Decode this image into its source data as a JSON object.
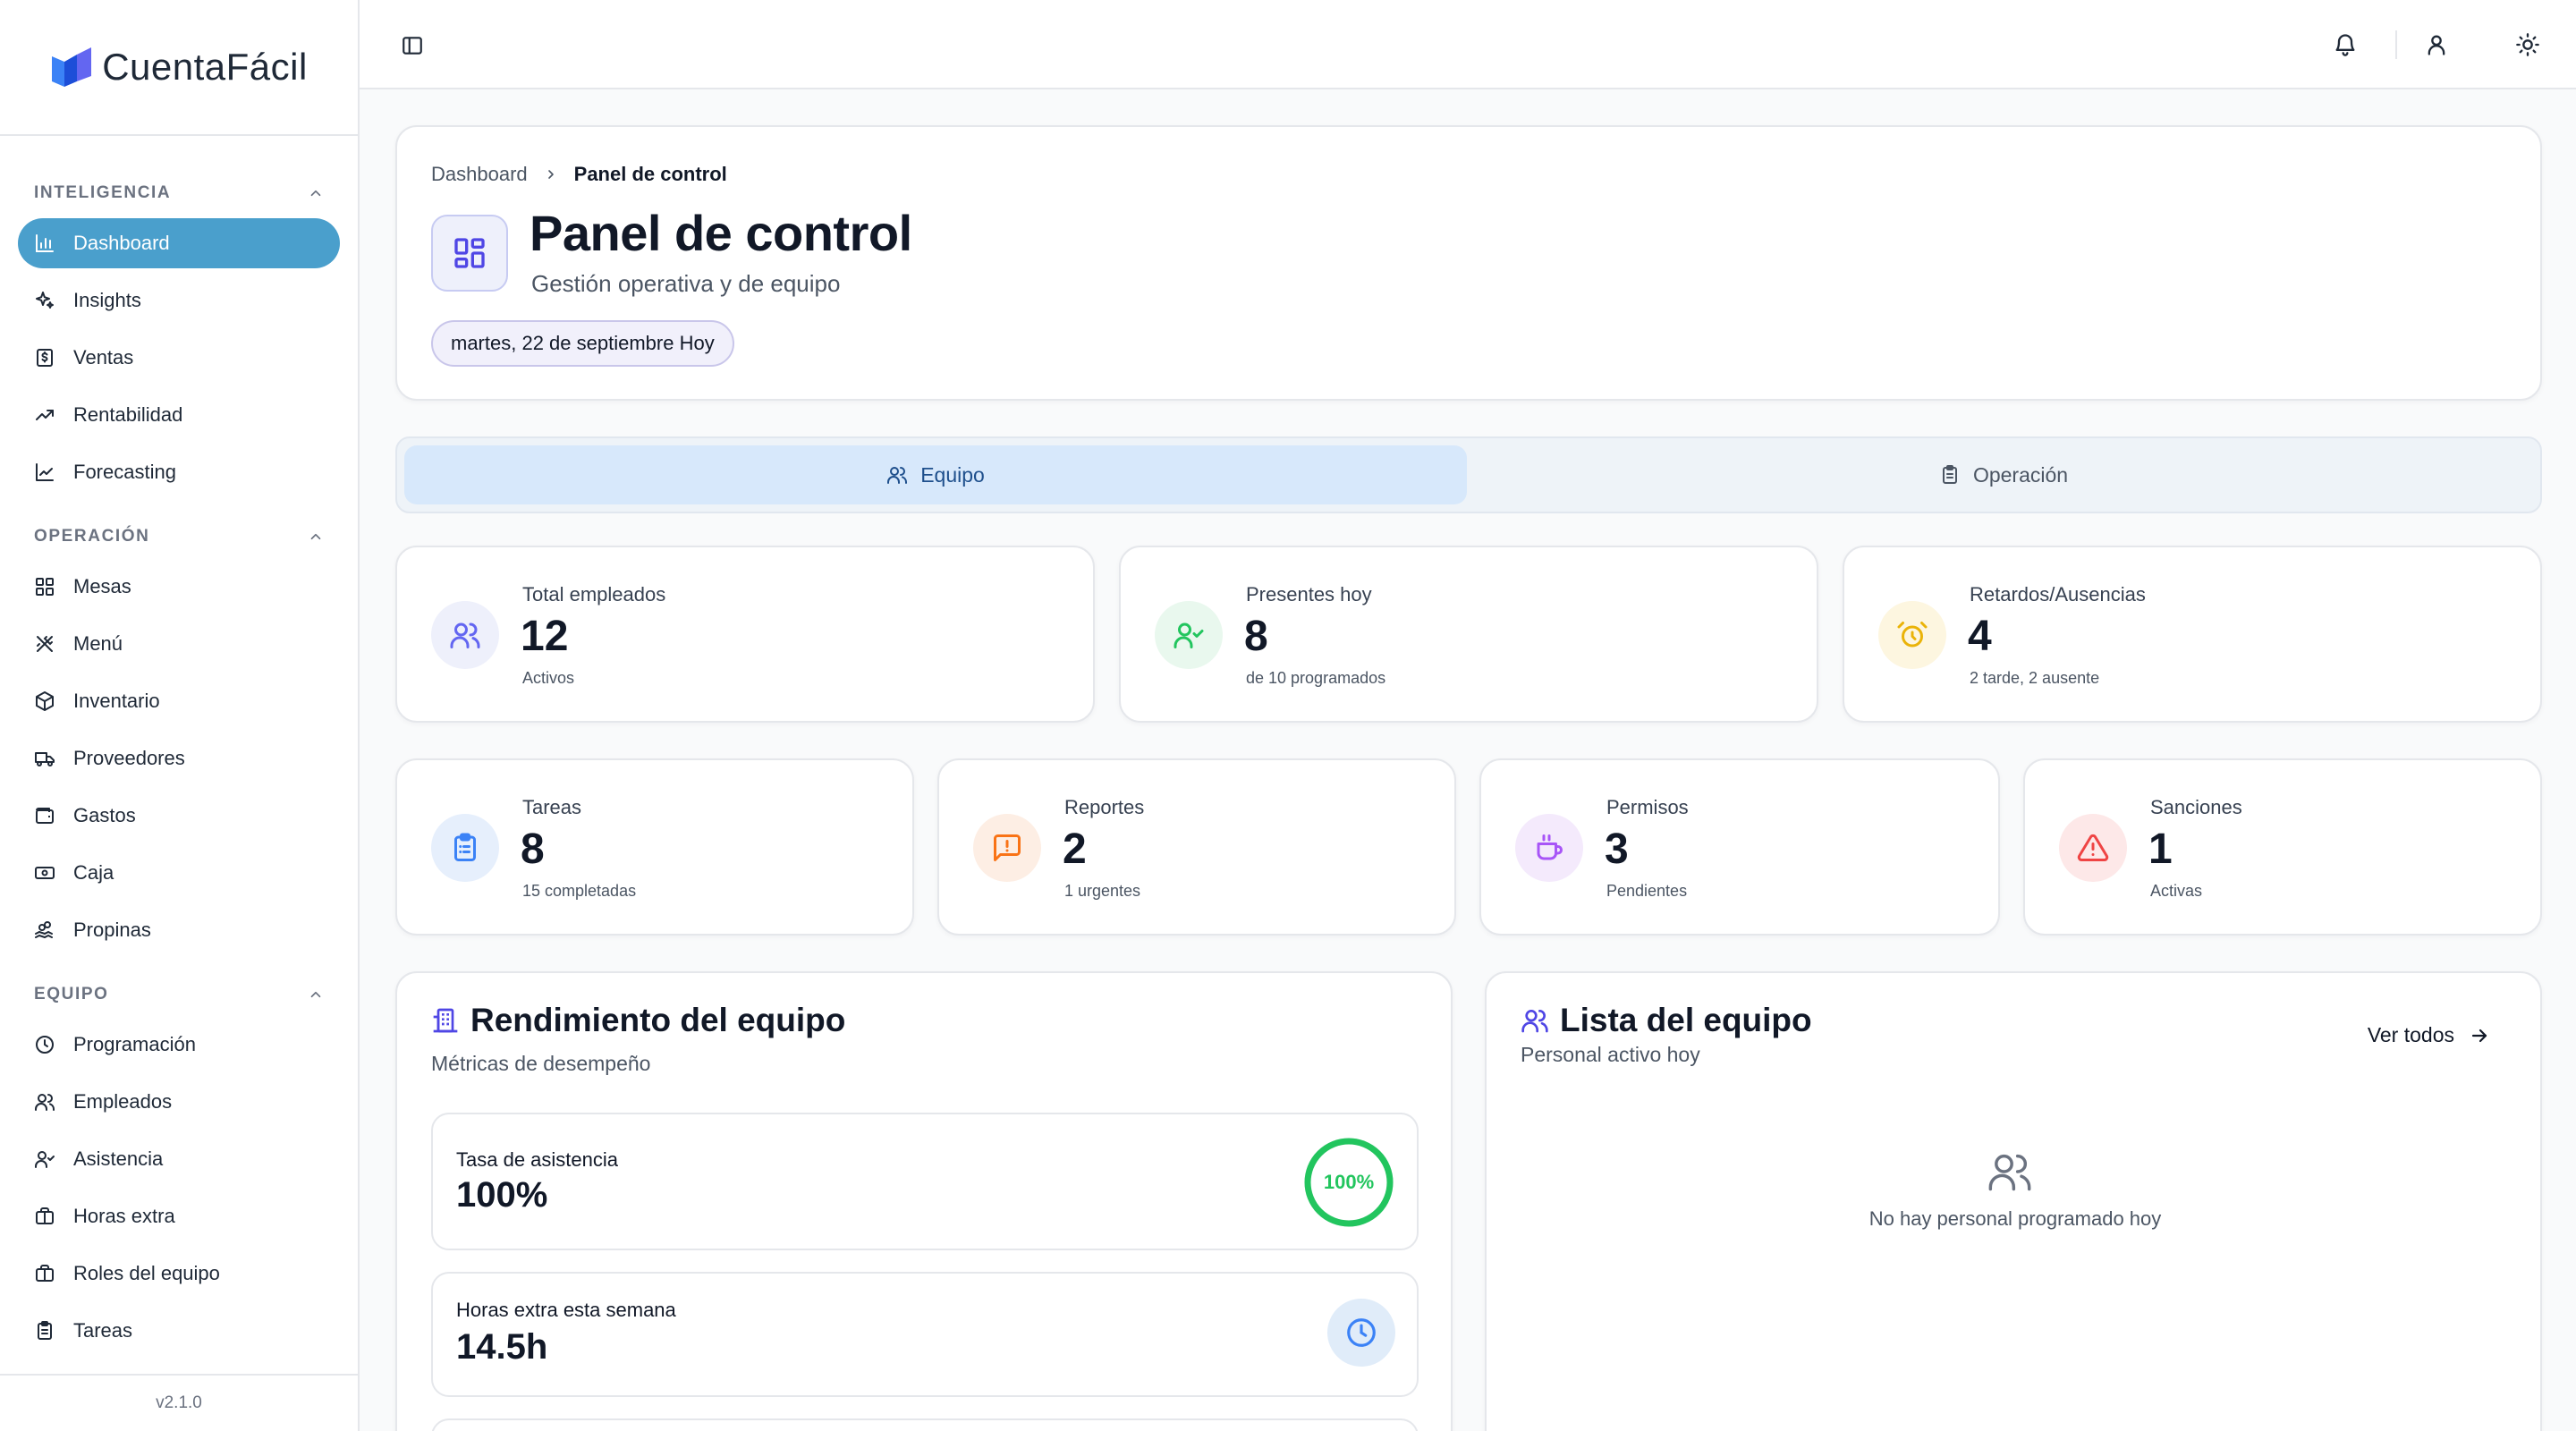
{
  "brand": {
    "name": "CuentaFácil"
  },
  "sidebar": {
    "sections": [
      {
        "title": "INTELIGENCIA",
        "items": [
          {
            "label": "Dashboard",
            "icon": "bar-chart-icon",
            "active": true
          },
          {
            "label": "Insights",
            "icon": "sparkles-icon"
          },
          {
            "label": "Ventas",
            "icon": "receipt-dollar-icon"
          },
          {
            "label": "Rentabilidad",
            "icon": "trending-up-icon"
          },
          {
            "label": "Forecasting",
            "icon": "line-chart-icon"
          }
        ]
      },
      {
        "title": "OPERACIÓN",
        "items": [
          {
            "label": "Mesas",
            "icon": "grid-icon"
          },
          {
            "label": "Menú",
            "icon": "utensils-icon"
          },
          {
            "label": "Inventario",
            "icon": "package-icon"
          },
          {
            "label": "Proveedores",
            "icon": "truck-icon"
          },
          {
            "label": "Gastos",
            "icon": "wallet-icon"
          },
          {
            "label": "Caja",
            "icon": "banknote-icon"
          },
          {
            "label": "Propinas",
            "icon": "hand-coins-icon"
          }
        ]
      },
      {
        "title": "EQUIPO",
        "items": [
          {
            "label": "Programación",
            "icon": "clock-icon"
          },
          {
            "label": "Empleados",
            "icon": "users-icon"
          },
          {
            "label": "Asistencia",
            "icon": "user-check-icon"
          },
          {
            "label": "Horas extra",
            "icon": "briefcase-icon"
          },
          {
            "label": "Roles del equipo",
            "icon": "briefcase-icon"
          },
          {
            "label": "Tareas",
            "icon": "clipboard-icon"
          }
        ]
      }
    ],
    "version": "v2.1.0"
  },
  "header": {
    "breadcrumb": [
      "Dashboard",
      "Panel de control"
    ],
    "title": "Panel de control",
    "subtitle": "Gestión operativa y de equipo",
    "date": "martes, 22 de septiembre Hoy"
  },
  "tabs": [
    {
      "label": "Equipo",
      "icon": "users-icon",
      "active": true
    },
    {
      "label": "Operación",
      "icon": "clipboard-icon",
      "active": false
    }
  ],
  "stats_row1": [
    {
      "label": "Total empleados",
      "value": "12",
      "sub": "Activos",
      "icon": "users-icon",
      "color": "#6366f1",
      "bg": "#eef0fb"
    },
    {
      "label": "Presentes hoy",
      "value": "8",
      "sub": "de 10 programados",
      "icon": "user-check-icon",
      "color": "#22c55e",
      "bg": "#e9f8ee"
    },
    {
      "label": "Retardos/Ausencias",
      "value": "4",
      "sub": "2 tarde, 2 ausente",
      "icon": "alarm-clock-icon",
      "color": "#eab308",
      "bg": "#fdf6e0"
    }
  ],
  "stats_row2": [
    {
      "label": "Tareas",
      "value": "8",
      "sub": "15 completadas",
      "icon": "clipboard-list-icon",
      "color": "#3b82f6",
      "bg": "#e6effc"
    },
    {
      "label": "Reportes",
      "value": "2",
      "sub": "1 urgentes",
      "icon": "message-alert-icon",
      "color": "#f97316",
      "bg": "#fdeee4"
    },
    {
      "label": "Permisos",
      "value": "3",
      "sub": "Pendientes",
      "icon": "coffee-icon",
      "color": "#a855f7",
      "bg": "#f4eafc"
    },
    {
      "label": "Sanciones",
      "value": "1",
      "sub": "Activas",
      "icon": "alert-triangle-icon",
      "color": "#ef4444",
      "bg": "#fde8e8"
    }
  ],
  "performance": {
    "title": "Rendimiento del equipo",
    "subtitle": "Métricas de desempeño",
    "metrics": [
      {
        "label": "Tasa de asistencia",
        "value": "100%",
        "ring_label": "100%",
        "ring_fraction": 1.0,
        "color": "#22c55e"
      },
      {
        "label": "Horas extra esta semana",
        "value": "14.5h",
        "icon": "clock-icon",
        "color": "#3b82f6"
      }
    ]
  },
  "team_list": {
    "title": "Lista del equipo",
    "subtitle": "Personal activo hoy",
    "see_all": "Ver todos",
    "empty": "No hay personal programado hoy"
  }
}
